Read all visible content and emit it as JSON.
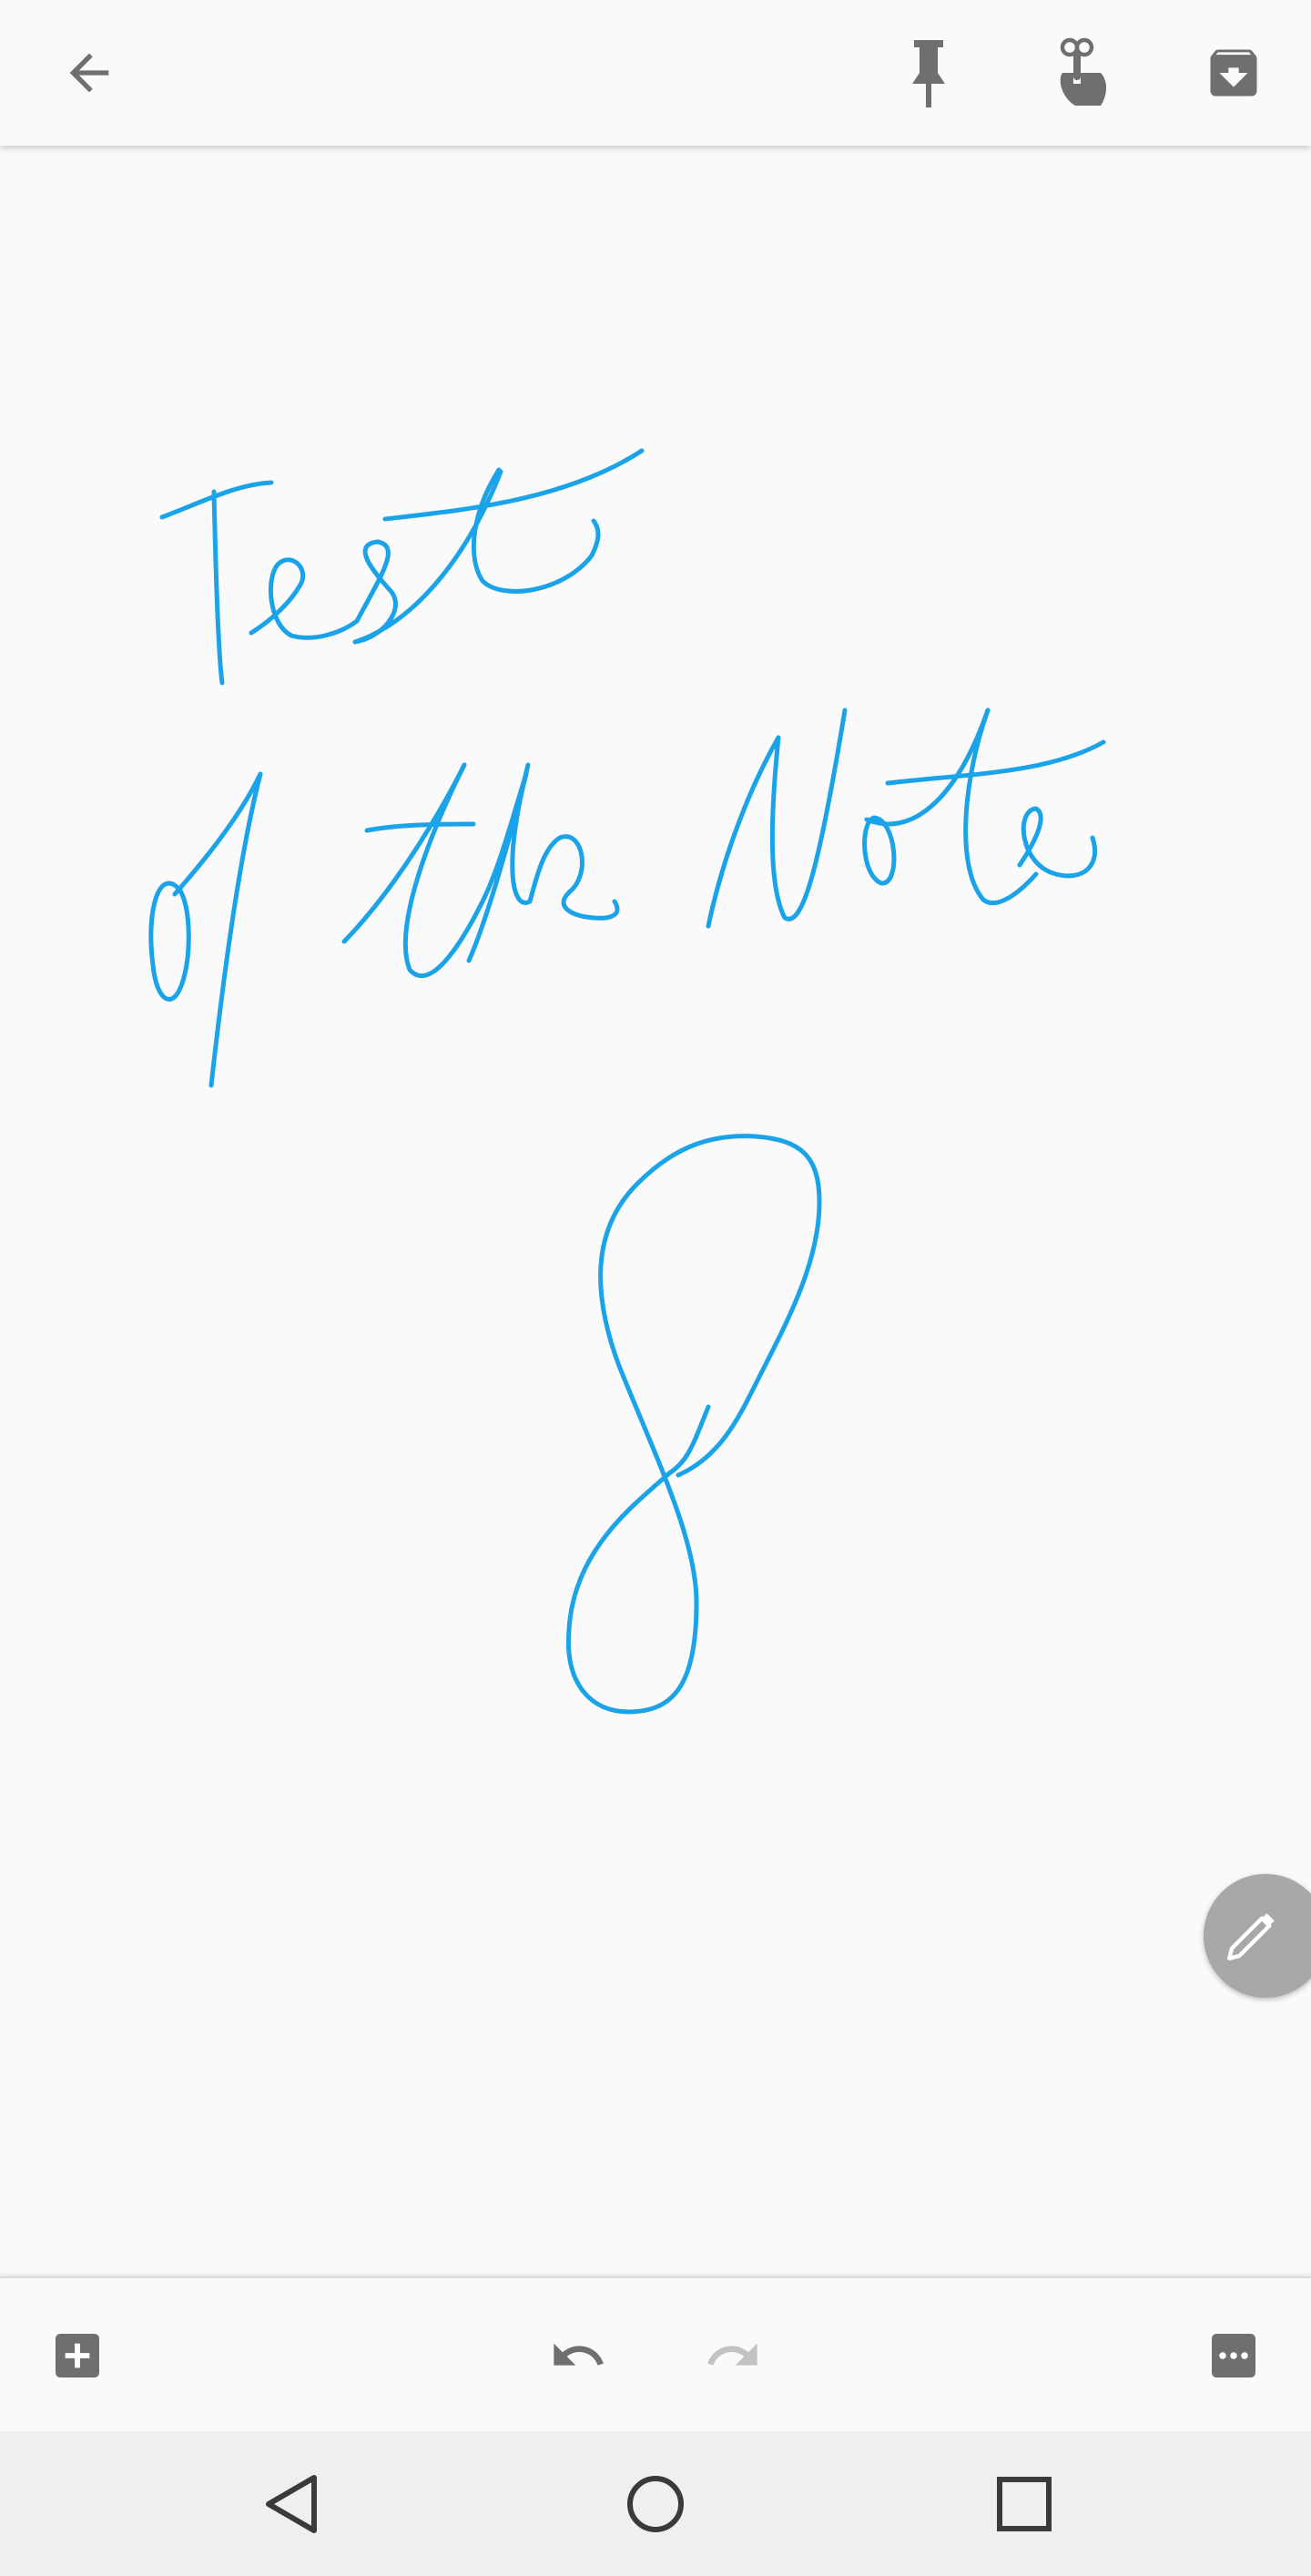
{
  "colors": {
    "ink": "#1aa3e8",
    "toolbar_icon": "#6f6f6f",
    "redo_disabled": "#c2c2c2",
    "fab": "#a8a8a8",
    "nav_icon": "#3a3a3a",
    "nav_background": "#efefef",
    "background": "#fafafa"
  },
  "top_bar": {
    "icons": [
      "back-arrow-icon",
      "pin-icon",
      "reminder-icon",
      "archive-icon"
    ]
  },
  "canvas": {
    "handwriting_lines": [
      "Test",
      "of the Note",
      "8"
    ]
  },
  "fab": {
    "icon": "pencil-icon"
  },
  "bottom_bar": {
    "icons": [
      "add-box-icon",
      "undo-icon",
      "redo-icon",
      "more-horizontal-icon"
    ],
    "redo_enabled": false
  },
  "nav_bar": {
    "icons": [
      "nav-back-triangle-icon",
      "nav-home-circle-icon",
      "nav-recents-square-icon"
    ]
  }
}
